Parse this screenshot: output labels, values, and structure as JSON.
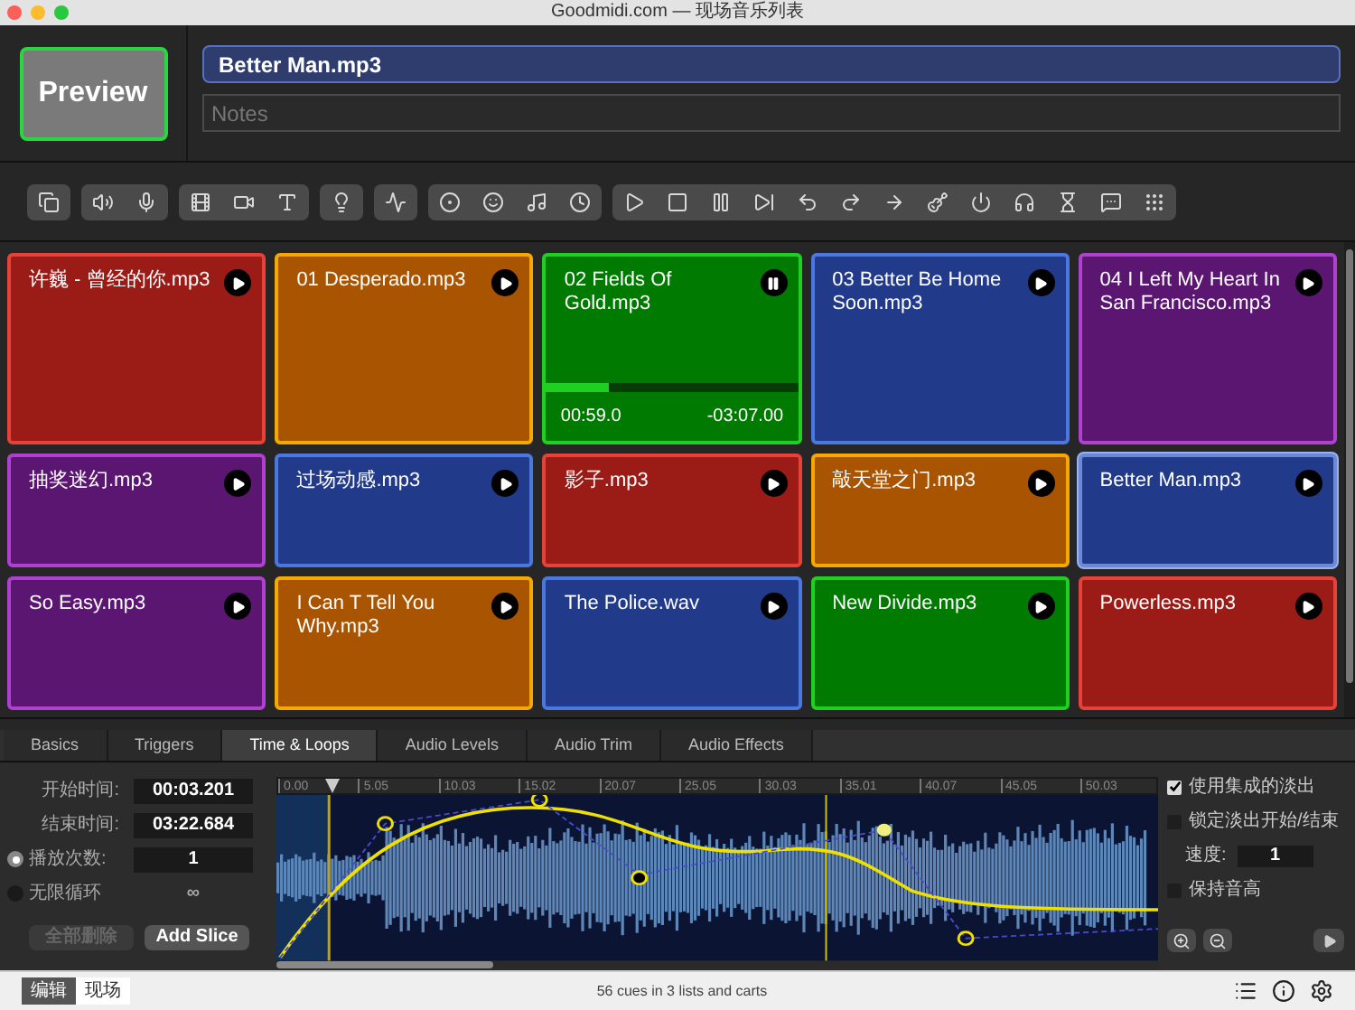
{
  "window": {
    "title": "Goodmidi.com — 现场音乐列表"
  },
  "preview_button": "Preview",
  "cue_name": {
    "value": "Better Man.mp3"
  },
  "notes": {
    "placeholder": "Notes"
  },
  "carts": [
    {
      "title": "许巍 - 曾经的你.mp3",
      "color": "#9b1c17",
      "playing": false,
      "selected": false
    },
    {
      "title": "01 Desperado.mp3",
      "color": "#a85400",
      "playing": false,
      "selected": false
    },
    {
      "title": "02 Fields Of Gold.mp3",
      "color": "#007a00",
      "playing": true,
      "selected": false,
      "level": 0.25,
      "elapsed": "00:59.0",
      "remaining": "-03:07.00"
    },
    {
      "title": "03 Better Be Home Soon.mp3",
      "color": "#213a8a",
      "playing": false,
      "selected": false
    },
    {
      "title": "04 I Left My Heart In San Francisco.mp3",
      "color": "#5a1670",
      "playing": false,
      "selected": false
    },
    {
      "title": "抽奖迷幻.mp3",
      "color": "#5a1670",
      "playing": false,
      "selected": false
    },
    {
      "title": "过场动感.mp3",
      "color": "#213a8a",
      "playing": false,
      "selected": false
    },
    {
      "title": "影子.mp3",
      "color": "#9b1c17",
      "playing": false,
      "selected": false
    },
    {
      "title": "敲天堂之门.mp3",
      "color": "#a85400",
      "playing": false,
      "selected": false
    },
    {
      "title": "Better Man.mp3",
      "color": "#213a8a",
      "playing": false,
      "selected": true
    },
    {
      "title": "So Easy.mp3",
      "color": "#5a1670",
      "playing": false,
      "selected": false
    },
    {
      "title": "I Can T Tell You Why.mp3",
      "color": "#a85400",
      "playing": false,
      "selected": false
    },
    {
      "title": "The Police.wav",
      "color": "#213a8a",
      "playing": false,
      "selected": false
    },
    {
      "title": "New Divide.mp3",
      "color": "#007a00",
      "playing": false,
      "selected": false
    },
    {
      "title": "Powerless.mp3",
      "color": "#9b1c17",
      "playing": false,
      "selected": false
    }
  ],
  "tabs": [
    {
      "label": "Basics",
      "selected": false
    },
    {
      "label": "Triggers",
      "selected": false
    },
    {
      "label": "Time & Loops",
      "selected": true
    },
    {
      "label": "Audio Levels",
      "selected": false
    },
    {
      "label": "Audio Trim",
      "selected": false
    },
    {
      "label": "Audio Effects",
      "selected": false
    }
  ],
  "times": [
    {
      "label": "开始时间:",
      "value": "00:03.201"
    },
    {
      "label": "结束时间:",
      "value": "03:22.684"
    }
  ],
  "loop_options": [
    {
      "label": "播放次数:",
      "value": "1",
      "selected": true
    },
    {
      "label": "无限循环",
      "value": "∞",
      "selected": false
    }
  ],
  "slice_buttons": [
    {
      "label": "全部删除",
      "disabled": true
    },
    {
      "label": "Add Slice",
      "disabled": false
    }
  ],
  "ruler": [
    "0.00",
    "5.05",
    "10.03",
    "15.02",
    "20.07",
    "25.05",
    "30.03",
    "35.01",
    "40.07",
    "45.05",
    "50.03"
  ],
  "options": [
    {
      "kind": "checkbox",
      "label": "使用集成的淡出",
      "checked": true
    },
    {
      "kind": "checkbox",
      "label": "锁定淡出开始/结束",
      "checked": false
    },
    {
      "kind": "field",
      "label": "速度:",
      "value": "1"
    },
    {
      "kind": "checkbox",
      "label": "保持音高",
      "checked": false
    }
  ],
  "mode_tabs": [
    {
      "label": "编辑",
      "selected": true
    },
    {
      "label": "现场",
      "selected": false
    }
  ],
  "status": "56 cues in 3 lists and carts"
}
